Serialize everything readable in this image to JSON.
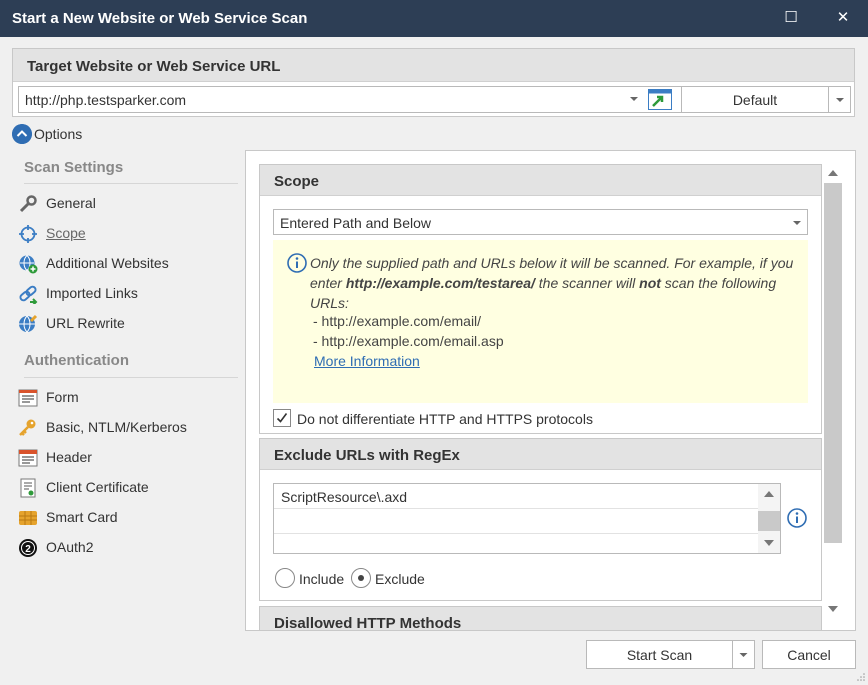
{
  "window": {
    "title": "Start a New Website or Web Service Scan",
    "maximize_glyph": "☐",
    "close_glyph": "✕"
  },
  "target": {
    "header": "Target Website or Web Service URL",
    "url": "http://php.testsparker.com",
    "profile": "Default"
  },
  "options_label": "Options",
  "nav": {
    "scan_settings_title": "Scan Settings",
    "scan_items": [
      {
        "label": "General",
        "icon": "wrench-icon"
      },
      {
        "label": "Scope",
        "icon": "crosshair-icon",
        "active": true
      },
      {
        "label": "Additional Websites",
        "icon": "globe-plus-icon"
      },
      {
        "label": "Imported Links",
        "icon": "link-icon"
      },
      {
        "label": "URL Rewrite",
        "icon": "globe-edit-icon"
      }
    ],
    "authentication_title": "Authentication",
    "auth_items": [
      {
        "label": "Form",
        "icon": "form-icon"
      },
      {
        "label": "Basic, NTLM/Kerberos",
        "icon": "key-icon"
      },
      {
        "label": "Header",
        "icon": "header-icon"
      },
      {
        "label": "Client Certificate",
        "icon": "certificate-icon"
      },
      {
        "label": "Smart Card",
        "icon": "smart-card-icon"
      },
      {
        "label": "OAuth2",
        "icon": "oauth2-icon"
      }
    ]
  },
  "scope": {
    "title": "Scope",
    "selected": "Entered Path and Below",
    "info_part1": "Only the supplied path and URLs below it will be scanned. For example, if you enter ",
    "info_example": "http://example.com/testarea/",
    "info_part2": " the scanner will ",
    "info_not": "not",
    "info_part3": " scan the following URLs:",
    "example_url_1": "- http://example.com/email/",
    "example_url_2": "- http://example.com/email.asp",
    "more_info_link": "More Information",
    "checkbox_label": "Do not differentiate HTTP and HTTPS protocols",
    "checkbox_checked": true
  },
  "exclude": {
    "title": "Exclude URLs with RegEx",
    "rows": [
      "ScriptResource\\.axd",
      "",
      ""
    ],
    "include_label": "Include",
    "exclude_label": "Exclude",
    "selected": "Exclude"
  },
  "next_section_title": "Disallowed HTTP Methods",
  "buttons": {
    "start_scan": "Start Scan",
    "cancel": "Cancel"
  },
  "colors": {
    "titlebar": "#2d3e55",
    "accent": "#2f6db3",
    "info_bg": "#ffffe1"
  }
}
